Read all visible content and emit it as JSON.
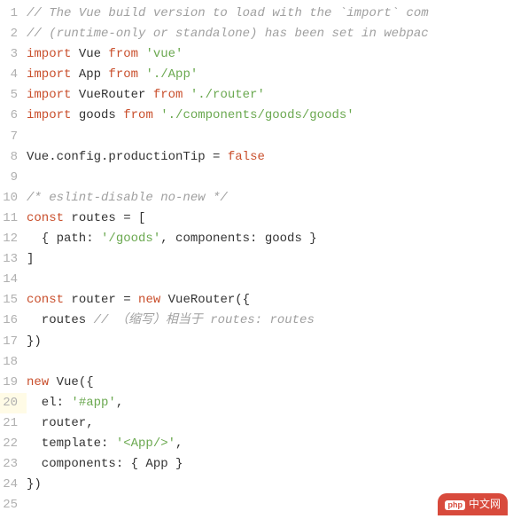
{
  "lines": [
    {
      "n": "1",
      "hl": false,
      "tokens": [
        [
          "c-comment",
          "// The Vue build version to load with the `import` com"
        ]
      ]
    },
    {
      "n": "2",
      "hl": false,
      "tokens": [
        [
          "c-comment",
          "// (runtime-only or standalone) has been set in webpac"
        ]
      ]
    },
    {
      "n": "3",
      "hl": false,
      "tokens": [
        [
          "c-kw",
          "import "
        ],
        [
          "c-ident",
          "Vue "
        ],
        [
          "c-kw",
          "from "
        ],
        [
          "c-str",
          "'vue'"
        ]
      ]
    },
    {
      "n": "4",
      "hl": false,
      "tokens": [
        [
          "c-kw",
          "import "
        ],
        [
          "c-ident",
          "App "
        ],
        [
          "c-kw",
          "from "
        ],
        [
          "c-str",
          "'./App'"
        ]
      ]
    },
    {
      "n": "5",
      "hl": false,
      "tokens": [
        [
          "c-kw",
          "import "
        ],
        [
          "c-ident",
          "VueRouter "
        ],
        [
          "c-kw",
          "from "
        ],
        [
          "c-str",
          "'./router'"
        ]
      ]
    },
    {
      "n": "6",
      "hl": false,
      "tokens": [
        [
          "c-kw",
          "import "
        ],
        [
          "c-ident",
          "goods "
        ],
        [
          "c-kw",
          "from "
        ],
        [
          "c-str",
          "'./components/goods/goods'"
        ]
      ]
    },
    {
      "n": "7",
      "hl": false,
      "tokens": [
        [
          "c-ident",
          ""
        ]
      ]
    },
    {
      "n": "8",
      "hl": false,
      "tokens": [
        [
          "c-ident",
          "Vue.config.productionTip "
        ],
        [
          "c-op",
          "= "
        ],
        [
          "c-bool",
          "false"
        ]
      ]
    },
    {
      "n": "9",
      "hl": false,
      "tokens": [
        [
          "c-ident",
          ""
        ]
      ]
    },
    {
      "n": "10",
      "hl": false,
      "tokens": [
        [
          "c-comment",
          "/* eslint-disable no-new */"
        ]
      ]
    },
    {
      "n": "11",
      "hl": false,
      "tokens": [
        [
          "c-kw",
          "const "
        ],
        [
          "c-ident",
          "routes "
        ],
        [
          "c-op",
          "= ["
        ]
      ]
    },
    {
      "n": "12",
      "hl": false,
      "tokens": [
        [
          "c-ident",
          "  { path: "
        ],
        [
          "c-str",
          "'/goods'"
        ],
        [
          "c-ident",
          ", components: goods }"
        ]
      ]
    },
    {
      "n": "13",
      "hl": false,
      "tokens": [
        [
          "c-ident",
          "]"
        ]
      ]
    },
    {
      "n": "14",
      "hl": false,
      "tokens": [
        [
          "c-ident",
          ""
        ]
      ]
    },
    {
      "n": "15",
      "hl": false,
      "tokens": [
        [
          "c-kw",
          "const "
        ],
        [
          "c-ident",
          "router "
        ],
        [
          "c-op",
          "= "
        ],
        [
          "c-new",
          "new "
        ],
        [
          "c-ident",
          "VueRouter({"
        ]
      ]
    },
    {
      "n": "16",
      "hl": false,
      "tokens": [
        [
          "c-ident",
          "  routes "
        ],
        [
          "c-comment",
          "// （缩写）相当于 routes: routes"
        ]
      ]
    },
    {
      "n": "17",
      "hl": false,
      "tokens": [
        [
          "c-ident",
          "})"
        ]
      ]
    },
    {
      "n": "18",
      "hl": false,
      "tokens": [
        [
          "c-ident",
          ""
        ]
      ]
    },
    {
      "n": "19",
      "hl": false,
      "tokens": [
        [
          "c-new",
          "new "
        ],
        [
          "c-ident",
          "Vue({"
        ]
      ]
    },
    {
      "n": "20",
      "hl": true,
      "tokens": [
        [
          "c-ident",
          "  el: "
        ],
        [
          "c-str",
          "'#app'"
        ],
        [
          "c-ident",
          ","
        ]
      ]
    },
    {
      "n": "21",
      "hl": false,
      "tokens": [
        [
          "c-ident",
          "  router,"
        ]
      ]
    },
    {
      "n": "22",
      "hl": false,
      "tokens": [
        [
          "c-ident",
          "  template: "
        ],
        [
          "c-str",
          "'<App/>'"
        ],
        [
          "c-ident",
          ","
        ]
      ]
    },
    {
      "n": "23",
      "hl": false,
      "tokens": [
        [
          "c-ident",
          "  components: { App }"
        ]
      ]
    },
    {
      "n": "24",
      "hl": false,
      "tokens": [
        [
          "c-ident",
          "})"
        ]
      ]
    },
    {
      "n": "25",
      "hl": false,
      "tokens": [
        [
          "c-ident",
          ""
        ]
      ]
    }
  ],
  "watermark": {
    "icon": "php",
    "text": "中文网"
  }
}
